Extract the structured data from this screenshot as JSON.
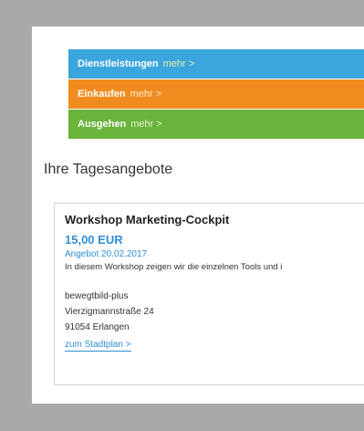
{
  "nav": [
    {
      "label": "Dienstleistungen",
      "more": "mehr >",
      "color": "#3aa6dd"
    },
    {
      "label": "Einkaufen",
      "more": "mehr >",
      "color": "#f08c1f"
    },
    {
      "label": "Ausgehen",
      "more": "mehr >",
      "color": "#6ab43c"
    }
  ],
  "section": {
    "title": "Ihre Tagesangebote"
  },
  "offer": {
    "title": "Workshop Marketing-Cockpit",
    "price": "15,00 EUR",
    "date": "Angebot 20.02.2017",
    "description": "In diesem Workshop zeigen wir die einzelnen Tools und i",
    "company": "bewegtbild-plus",
    "street": "Vierzigmannstraße 24",
    "city": "91054 Erlangen",
    "map_link": "zum Stadtplan >"
  }
}
